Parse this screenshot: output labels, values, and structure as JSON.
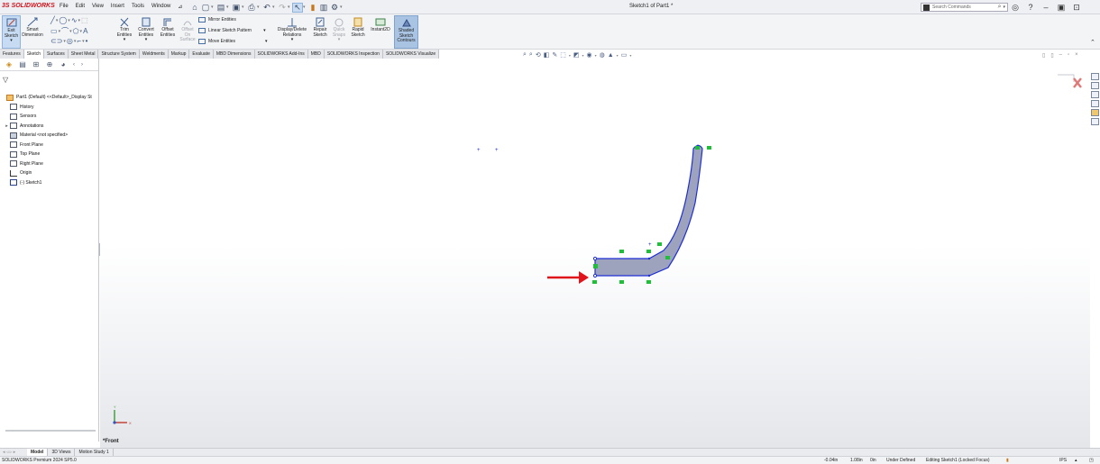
{
  "app": {
    "logo_text": "SOLIDWORKS",
    "window_title": "Sketch1 of Part1 *",
    "menus": [
      "File",
      "Edit",
      "View",
      "Insert",
      "Tools",
      "Window"
    ]
  },
  "search": {
    "placeholder": "Search Commands"
  },
  "ribbon": {
    "exit_sketch": "Exit\nSketch",
    "smart_dimension": "Smart\nDimension",
    "trim_entities": "Trim\nEntities",
    "convert_entities": "Convert\nEntities",
    "offset_entities": "Offset\nEntities",
    "offset_on_surface": "Offset\nOn\nSurface",
    "mirror_entities": "Mirror Entities",
    "linear_sketch_pattern": "Linear Sketch Pattern",
    "move_entities": "Move Entities",
    "display_delete_relations": "Display/Delete\nRelations",
    "repair_sketch": "Repair\nSketch",
    "quick_snaps": "Quick\nSnaps",
    "rapid_sketch": "Rapid\nSketch",
    "instant2d": "Instant2D",
    "shaded_sketch_contours": "Shaded\nSketch\nContours"
  },
  "tabs": [
    "Features",
    "Sketch",
    "Surfaces",
    "Sheet Metal",
    "Structure System",
    "Weldments",
    "Markup",
    "Evaluate",
    "MBD Dimensions",
    "SOLIDWORKS Add-Ins",
    "MBD",
    "SOLIDWORKS Inspection",
    "SOLIDWORKS Visualize"
  ],
  "active_tab": "Sketch",
  "feature_tree": [
    {
      "label": "Part1 (Default) <<Default>_Display St",
      "icon": "part-icon",
      "expand": ""
    },
    {
      "label": "History",
      "icon": "history-icon",
      "expand": ""
    },
    {
      "label": "Sensors",
      "icon": "sensor-icon",
      "expand": ""
    },
    {
      "label": "Annotations",
      "icon": "annotation-icon",
      "expand": "▸"
    },
    {
      "label": "Material <not specified>",
      "icon": "material-icon",
      "expand": ""
    },
    {
      "label": "Front Plane",
      "icon": "plane-icon",
      "expand": ""
    },
    {
      "label": "Top Plane",
      "icon": "plane-icon",
      "expand": ""
    },
    {
      "label": "Right Plane",
      "icon": "plane-icon",
      "expand": ""
    },
    {
      "label": "Origin",
      "icon": "origin-icon",
      "expand": ""
    },
    {
      "label": "(-) Sketch1",
      "icon": "sketch-icon",
      "expand": ""
    }
  ],
  "view_label": "*Front",
  "bottom_tabs": [
    "Model",
    "3D Views",
    "Motion Study 1"
  ],
  "active_bottom_tab": "Model",
  "status": {
    "product": "SOLIDWORKS Premium 2024 SP5.0",
    "x_coord": "-0.04in",
    "y_coord": "1.08in",
    "z_coord": "0in",
    "definition": "Under Defined",
    "editing": "Editing Sketch1 (Locked Focus)",
    "units": "IPS"
  },
  "colors": {
    "accent_blue": "#1e2fd6",
    "shaded_fill": "#9ea3bd",
    "relation_green": "#1fbf3a",
    "arrow_red": "#e0141b",
    "logo_red": "#d0111b"
  }
}
